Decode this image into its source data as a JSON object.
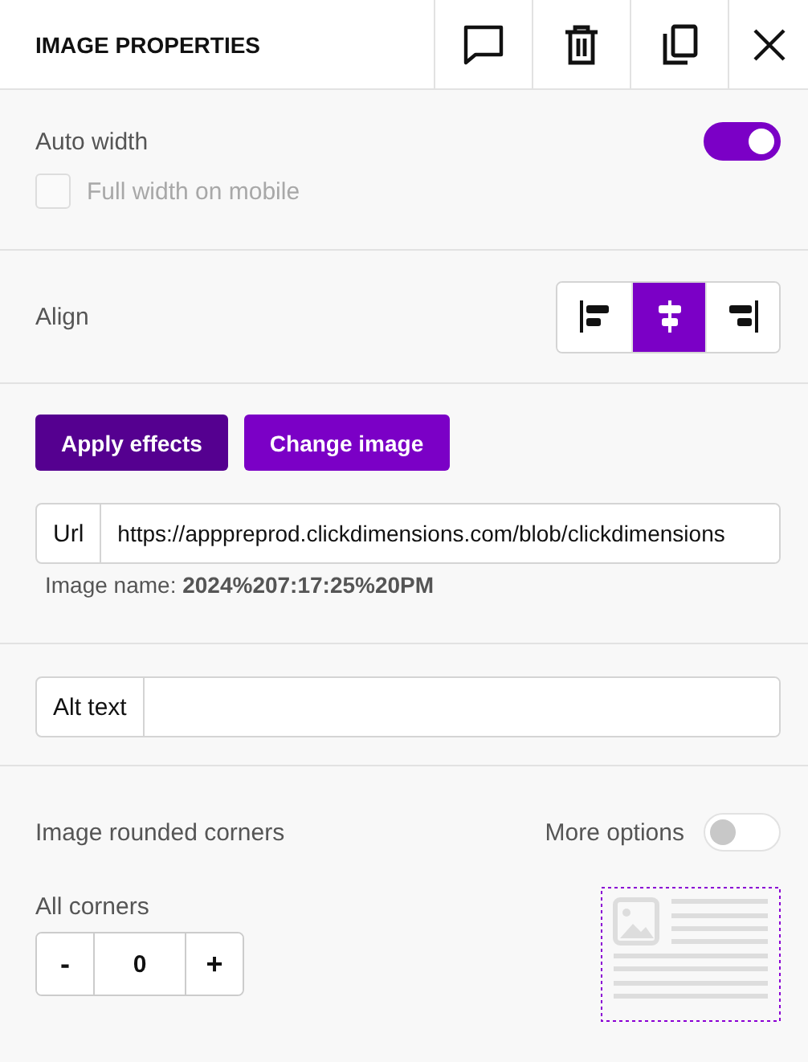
{
  "panel": {
    "title": "IMAGE PROPERTIES"
  },
  "header_actions": [
    {
      "kind": "comment"
    },
    {
      "kind": "delete"
    },
    {
      "kind": "duplicate"
    },
    {
      "kind": "close"
    }
  ],
  "auto_width": {
    "label": "Auto width",
    "on": true
  },
  "full_width_mobile": {
    "label": "Full width on mobile",
    "checked": false,
    "disabled": true
  },
  "align": {
    "label": "Align",
    "options": [
      {
        "kind": "left",
        "selected": false
      },
      {
        "kind": "center",
        "selected": true
      },
      {
        "kind": "right",
        "selected": false
      }
    ]
  },
  "buttons": [
    {
      "label": "Apply effects",
      "kind": "dark"
    },
    {
      "label": "Change image",
      "kind": "primary"
    }
  ],
  "url": {
    "label": "Url",
    "value": "https://apppreprod.clickdimensions.com/blob/clickdimensions"
  },
  "image_name": "Image name: **2024%207:17:25%20PM**",
  "alt_text": {
    "label": "Alt text"
  },
  "rounded": {
    "label": "Image rounded corners",
    "more_options": {
      "label": "More options",
      "on": false
    },
    "all_corners": {
      "label": "All corners",
      "minus": "-",
      "value": "0",
      "plus": "+"
    }
  }
}
